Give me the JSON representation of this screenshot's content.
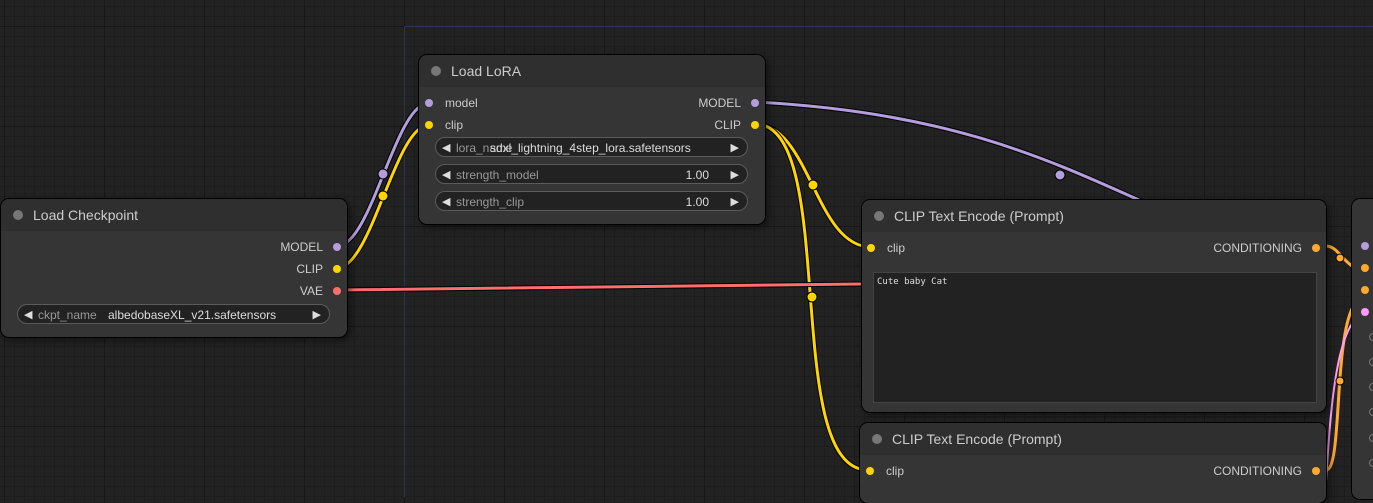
{
  "colors": {
    "model": "#b39ddb",
    "clip": "#ffd500",
    "vae": "#ff6e6e",
    "conditioning": "#ffa931",
    "latent": "#ff9cf9"
  },
  "nodes": {
    "load_checkpoint": {
      "title": "Load Checkpoint",
      "outputs": [
        "MODEL",
        "CLIP",
        "VAE"
      ],
      "widget": {
        "label": "ckpt_name",
        "value": "albedobaseXL_v21.safetensors"
      }
    },
    "load_lora": {
      "title": "Load LoRA",
      "inputs": [
        "model",
        "clip"
      ],
      "outputs": [
        "MODEL",
        "CLIP"
      ],
      "widgets": [
        {
          "label": "lora_name",
          "value": "sdxl_lightning_4step_lora.safetensors"
        },
        {
          "label": "strength_model",
          "value": "1.00"
        },
        {
          "label": "strength_clip",
          "value": "1.00"
        }
      ]
    },
    "clip_text_encode_1": {
      "title": "CLIP Text Encode (Prompt)",
      "input": "clip",
      "output": "CONDITIONING",
      "text": "Cute baby Cat"
    },
    "clip_text_encode_2": {
      "title": "CLIP Text Encode (Prompt)",
      "input": "clip",
      "output": "CONDITIONING"
    }
  }
}
